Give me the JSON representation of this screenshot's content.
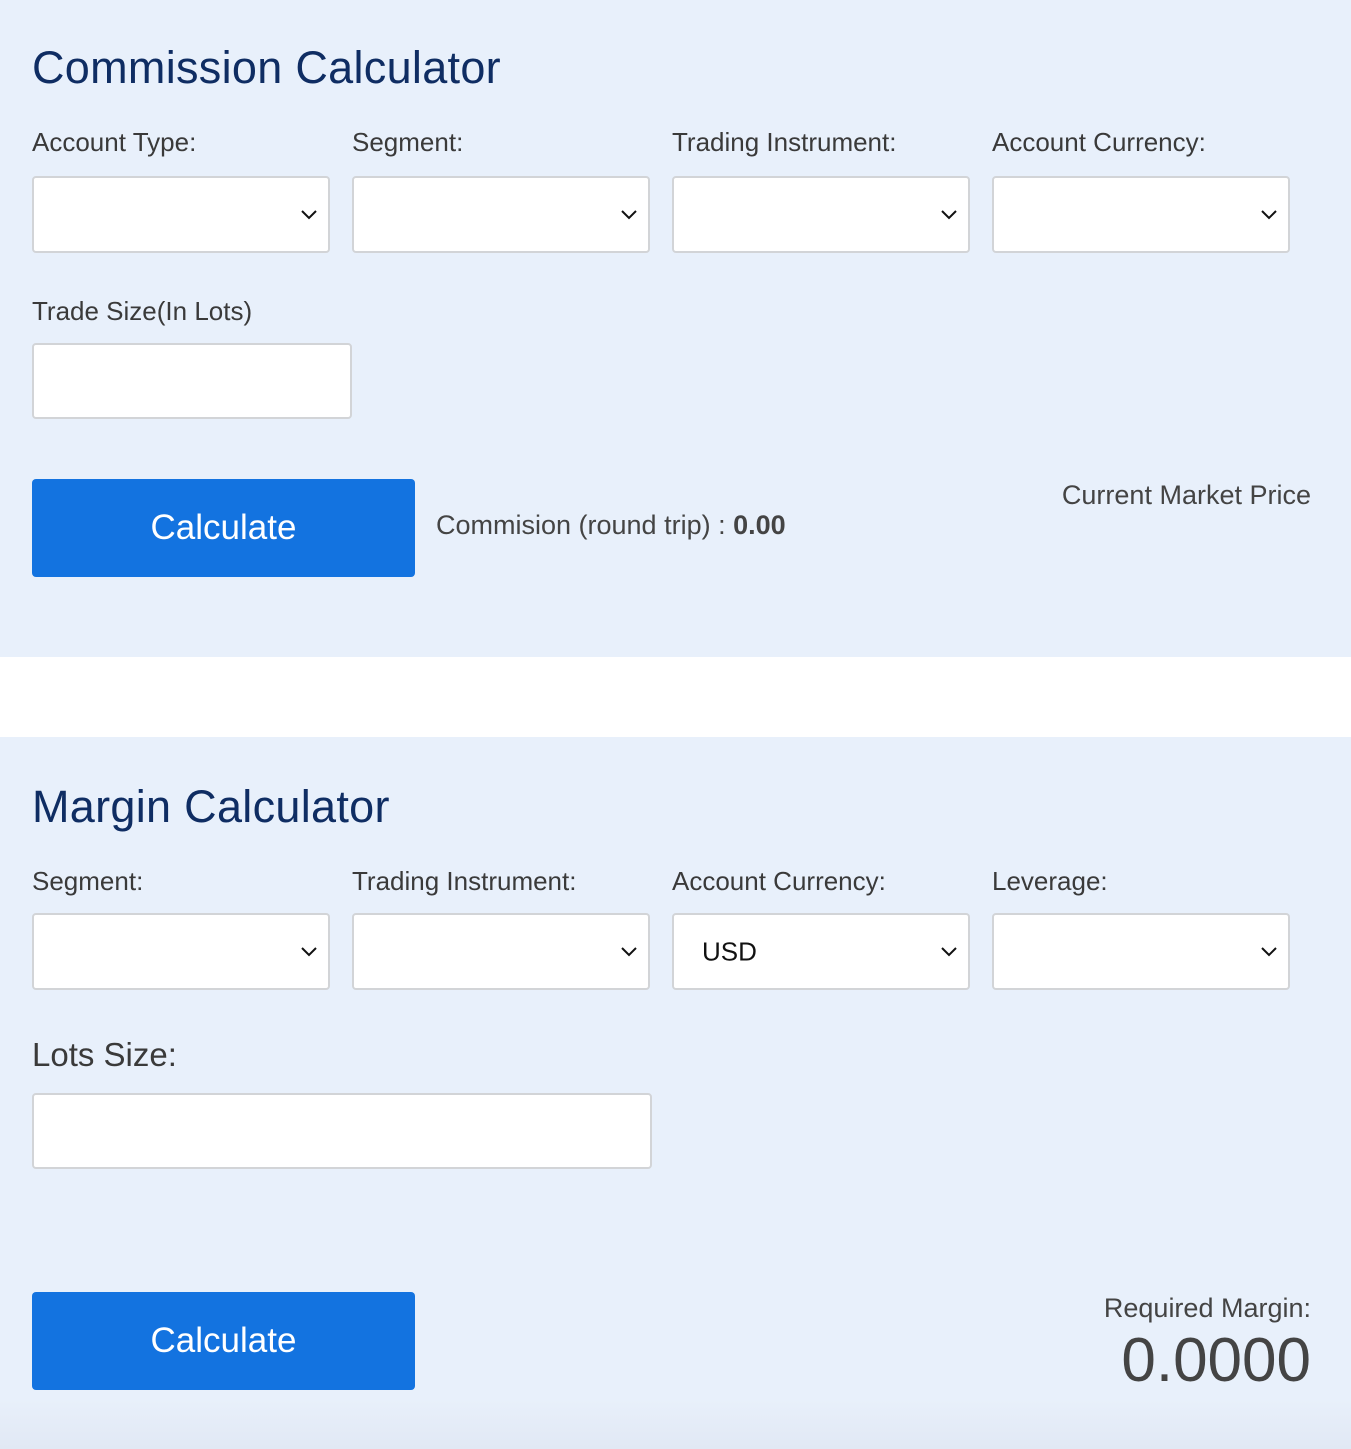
{
  "commission_calculator": {
    "title": "Commission Calculator",
    "fields": [
      {
        "label": "Account Type:",
        "type": "select",
        "value": ""
      },
      {
        "label": "Segment:",
        "type": "select",
        "value": ""
      },
      {
        "label": "Trading Instrument:",
        "type": "select",
        "value": ""
      },
      {
        "label": "Account Currency:",
        "type": "select",
        "value": ""
      }
    ],
    "trade_size": {
      "label": "Trade Size(In Lots)",
      "value": ""
    },
    "calculate_label": "Calculate",
    "result_label": "Commision (round trip) : ",
    "result_value": "0.00",
    "market_price_label": "Current Market Price"
  },
  "margin_calculator": {
    "title": "Margin Calculator",
    "fields": [
      {
        "label": "Segment:",
        "type": "select",
        "value": ""
      },
      {
        "label": "Trading Instrument:",
        "type": "select",
        "value": ""
      },
      {
        "label": "Account Currency:",
        "type": "select",
        "value": "USD"
      },
      {
        "label": "Leverage:",
        "type": "select",
        "value": ""
      }
    ],
    "lots_size": {
      "label": "Lots Size:",
      "value": ""
    },
    "calculate_label": "Calculate",
    "required_margin_label": "Required Margin:",
    "required_margin_value": "0.0000"
  },
  "colors": {
    "section_bg": "#e8f0fb",
    "title": "#0f2d63",
    "button": "#1373e0",
    "text": "#3a3a3a"
  }
}
